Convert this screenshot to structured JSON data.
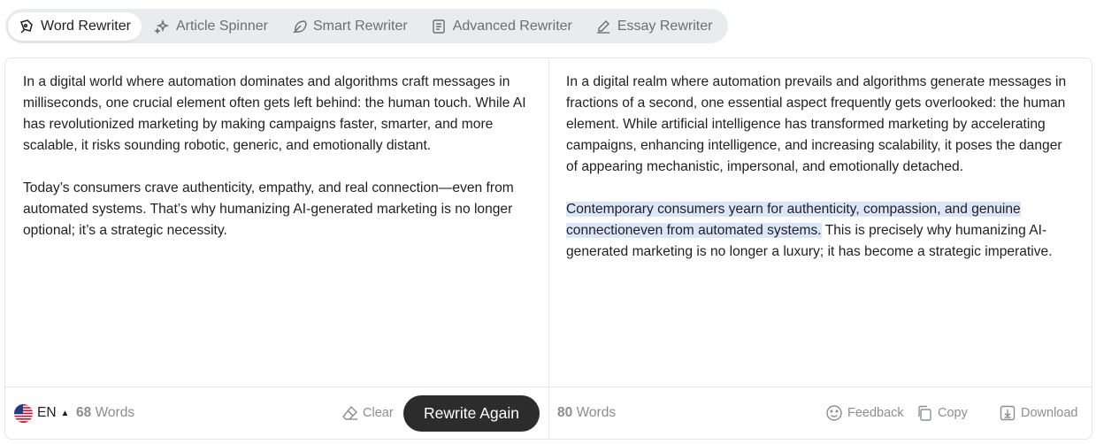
{
  "tabs": [
    {
      "label": "Word Rewriter",
      "icon": "word-rewriter-icon",
      "active": true
    },
    {
      "label": "Article Spinner",
      "icon": "sparkle-icon",
      "active": false
    },
    {
      "label": "Smart Rewriter",
      "icon": "feather-icon",
      "active": false
    },
    {
      "label": "Advanced Rewriter",
      "icon": "document-icon",
      "active": false
    },
    {
      "label": "Essay Rewriter",
      "icon": "pen-icon",
      "active": false
    }
  ],
  "input": {
    "paragraphs": [
      "In a digital world where automation dominates and algorithms craft messages in milliseconds, one crucial element often gets left behind: the human touch. While AI has revolutionized marketing by making campaigns faster, smarter, and more scalable, it risks sounding robotic, generic, and emotionally distant.",
      "Today’s consumers crave authenticity, empathy, and real connection—even from automated systems. That’s why humanizing AI-generated marketing is no longer optional; it’s a strategic necessity."
    ],
    "language": "EN",
    "word_count": "68",
    "word_label": "Words",
    "clear_label": "Clear",
    "rewrite_label": "Rewrite Again"
  },
  "output": {
    "paragraph1": "In a digital realm where automation prevails and algorithms generate messages in fractions of a second, one essential aspect frequently gets overlooked: the human element. While artificial intelligence has transformed marketing by accelerating campaigns, enhancing intelligence, and increasing scalability, it poses the danger of appearing mechanistic, impersonal, and emotionally detached.",
    "paragraph2_highlighted": "Contemporary consumers yearn for authenticity, compassion, and genuine connectioneven from automated systems.",
    "paragraph2_rest": " This is precisely why humanizing AI-generated marketing is no longer a luxury; it has become a strategic imperative.",
    "word_count": "80",
    "word_label": "Words",
    "feedback_label": "Feedback",
    "copy_label": "Copy",
    "download_label": "Download"
  },
  "colors": {
    "accent_button": "#2c2c2c",
    "highlight": "#dbe7f8",
    "muted_text": "#8a8e94",
    "tab_bar": "#e9ebee"
  }
}
